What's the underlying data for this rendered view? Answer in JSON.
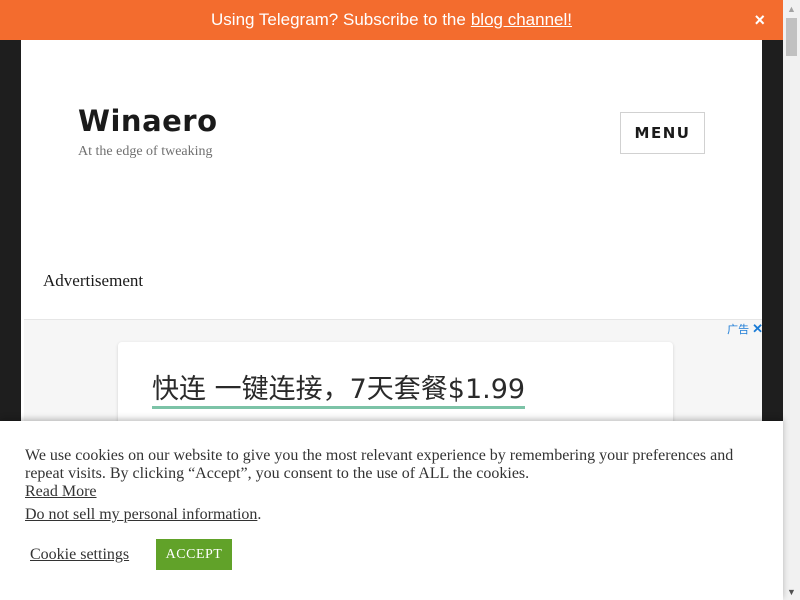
{
  "notice": {
    "text": "Using Telegram? Subscribe to the",
    "link": "blog channel!",
    "close": "×"
  },
  "site": {
    "title": "Winaero",
    "tagline": "At the edge of tweaking",
    "menu_label": "MENU"
  },
  "ad": {
    "label": "Advertisement",
    "choices_label": "广告",
    "close": "✕",
    "headline": "快连 一键连接，7天套餐$1.99"
  },
  "cookie": {
    "text": "We use cookies on our website to give you the most relevant experience by remembering your preferences and repeat visits. By clicking “Accept”, you consent to the use of ALL the cookies.",
    "read_more": "Read More",
    "do_not_sell": "Do not sell my personal information",
    "do_not_sell_suffix": ".",
    "settings_label": "Cookie settings",
    "accept_label": "ACCEPT"
  },
  "colors": {
    "notice_bg": "#f36c2e",
    "accept_bg": "#61a229",
    "page_bg": "#1e1e1e",
    "ad_underline": "#7cc3a7"
  },
  "scrollbar": {
    "up_icon": "▲",
    "down_icon": "▼"
  }
}
